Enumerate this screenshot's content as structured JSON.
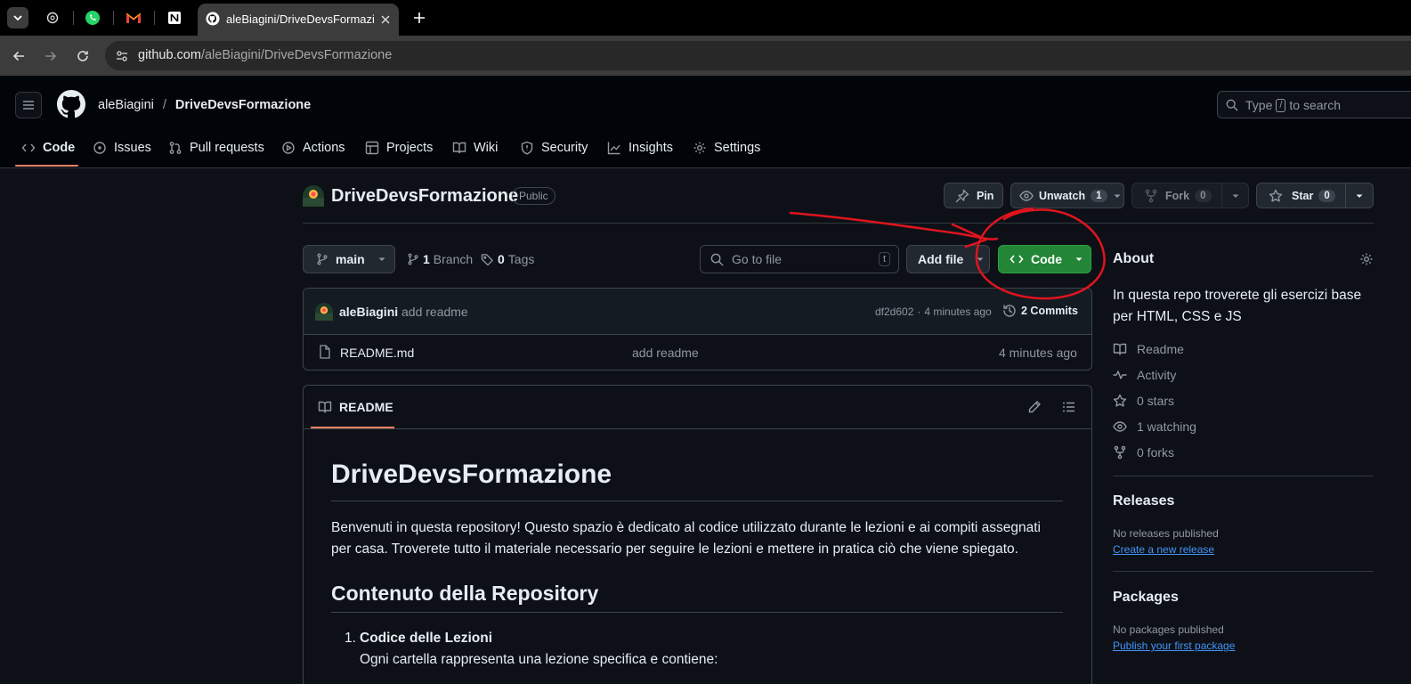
{
  "browser": {
    "active_tab_title": "aleBiagini/DriveDevsFormazione",
    "url_host": "github.com",
    "url_path": "/aleBiagini/DriveDevsFormazione"
  },
  "header": {
    "owner": "aleBiagini",
    "separator": "/",
    "repo": "DriveDevsFormazione",
    "search_prefix": "Type",
    "search_key": "/",
    "search_suffix": "to search"
  },
  "nav_tabs": [
    "Code",
    "Issues",
    "Pull requests",
    "Actions",
    "Projects",
    "Wiki",
    "Security",
    "Insights",
    "Settings"
  ],
  "repo": {
    "name": "DriveDevsFormazione",
    "visibility": "Public",
    "pin_label": "Pin",
    "unwatch_label": "Unwatch",
    "watch_count": "1",
    "fork_label": "Fork",
    "fork_count": "0",
    "star_label": "Star",
    "star_count": "0"
  },
  "toolbar": {
    "branch": "main",
    "branch_count": "1",
    "branch_label": "Branch",
    "tags_count": "0",
    "tags_label": "Tags",
    "go_to_file": "Go to file",
    "go_to_file_key": "t",
    "add_file": "Add file",
    "code": "Code"
  },
  "commit": {
    "author": "aleBiagini",
    "message": "add readme",
    "hash": "df2d602",
    "separator": "·",
    "time": "4 minutes ago",
    "count": "2 Commits"
  },
  "files": [
    {
      "name": "README.md",
      "message": "add readme",
      "time": "4 minutes ago"
    }
  ],
  "readme": {
    "tab_label": "README",
    "h1": "DriveDevsFormazione",
    "intro": "Benvenuti in questa repository! Questo spazio è dedicato al codice utilizzato durante le lezioni e ai compiti assegnati per casa. Troverete tutto il materiale necessario per seguire le lezioni e mettere in pratica ciò che viene spiegato.",
    "h2": "Contenuto della Repository",
    "list_number": "1.",
    "list_title": "Codice delle Lezioni",
    "list_text": "Ogni cartella rappresenta una lezione specifica e contiene:"
  },
  "about": {
    "title": "About",
    "description": "In questa repo troverete gli esercizi base per HTML, CSS e JS",
    "items": [
      {
        "icon": "book-icon",
        "label": "Readme"
      },
      {
        "icon": "pulse-icon",
        "label": "Activity"
      },
      {
        "icon": "star-icon",
        "label": "0 stars"
      },
      {
        "icon": "eye-icon",
        "label": "1 watching"
      },
      {
        "icon": "fork-icon",
        "label": "0 forks"
      }
    ],
    "releases_title": "Releases",
    "releases_none": "No releases published",
    "releases_link": "Create a new release",
    "packages_title": "Packages",
    "packages_none": "No packages published",
    "packages_link": "Publish your first package"
  },
  "colors": {
    "background": "#0d1117",
    "header": "#010409",
    "accent_green": "#238636",
    "link": "#4493f8",
    "annotation_red": "#e0141e",
    "tab_underline": "#f78166"
  }
}
